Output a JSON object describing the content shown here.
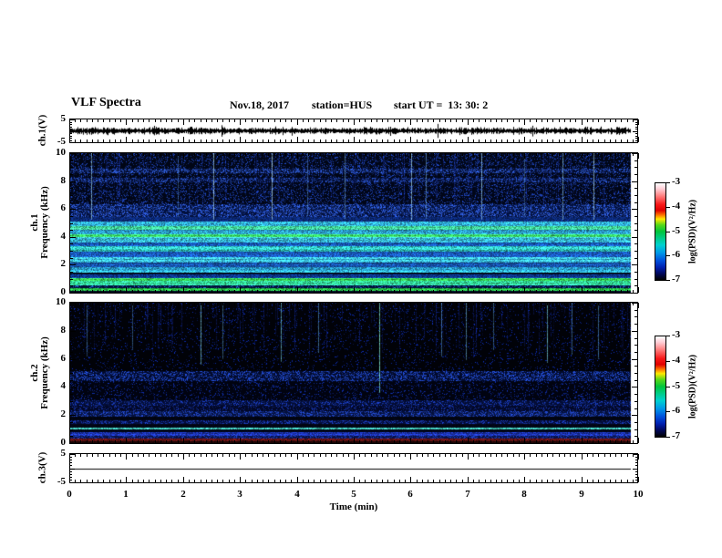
{
  "header": {
    "title": "VLF Spectra",
    "date": "Nov.18, 2017",
    "station": "station=HUS",
    "start_ut": "start UT =  13: 30: 2"
  },
  "time_axis": {
    "label": "Time (min)",
    "range": [
      0,
      10
    ],
    "major_ticks": [
      0,
      1,
      2,
      3,
      4,
      5,
      6,
      7,
      8,
      9,
      10
    ],
    "minor_step": 0.1
  },
  "freq_axis": {
    "range": [
      0,
      10
    ],
    "major_ticks": [
      10,
      8,
      6,
      4,
      2,
      0
    ],
    "minor_step": 0.5
  },
  "volt_axis": {
    "range": [
      -5,
      5
    ],
    "major_ticks": [
      5,
      -5
    ],
    "minor_step": 1
  },
  "colorbar": {
    "label": "log(PSD)(V²/Hz)",
    "ticks": [
      -3,
      -4,
      -5,
      -6,
      -7
    ],
    "gradient": [
      "#ffffff 0%",
      "#ffccd4 6%",
      "#ff8080 13%",
      "#f81818 22%",
      "#e00000 28%",
      "#ff7800 33%",
      "#ffe800 37%",
      "#58d818 43%",
      "#00c43c 50%",
      "#00cc88 57%",
      "#00d0d0 64%",
      "#0098e8 72%",
      "#0050dc 80%",
      "#0020b0 87%",
      "#000860 93%",
      "#000000 100%"
    ]
  },
  "render": {
    "data_fraction": 0.988
  },
  "chart_data": [
    {
      "type": "line",
      "name": "ch1_waveform",
      "ylabel": "ch.1(V)",
      "xlim": [
        0,
        10
      ],
      "ylim": [
        -5,
        5
      ],
      "signal": "dense broadband noise trace centered on 0 V",
      "noise_amp_v": 1.3,
      "seed": 7
    },
    {
      "type": "heatmap",
      "name": "ch1_spectrogram",
      "ylabel_lines": [
        "ch.1",
        "Frequency (kHz)"
      ],
      "xlim": [
        0,
        10
      ],
      "ylim": [
        0,
        10
      ],
      "clim": [
        -7,
        -3
      ],
      "background": "#010512",
      "seed": 13,
      "bands": [
        {
          "f": [
            0.0,
            0.15
          ],
          "color": "#000a20"
        },
        {
          "f": [
            0.15,
            0.32
          ],
          "color": "#28c048"
        },
        {
          "f": [
            0.32,
            0.55
          ],
          "color": "#020c38",
          "speckle": 0.3,
          "speckle_color": "#2060c8"
        },
        {
          "f": [
            0.55,
            0.88
          ],
          "color": "#30d890"
        },
        {
          "f": [
            0.88,
            1.02
          ],
          "color": "#38dc58"
        },
        {
          "f": [
            1.02,
            1.32
          ],
          "color": "#0c3c98"
        },
        {
          "f": [
            1.32,
            1.45
          ],
          "color": "#020818"
        },
        {
          "f": [
            1.45,
            1.82
          ],
          "color": "#2ca8dc"
        },
        {
          "f": [
            1.82,
            2.18
          ],
          "color": "#1858b8"
        },
        {
          "f": [
            2.18,
            2.55
          ],
          "color": "#38bce4"
        },
        {
          "f": [
            2.55,
            2.92
          ],
          "color": "#1854b4"
        },
        {
          "f": [
            2.92,
            3.32
          ],
          "color": "#30c8c0"
        },
        {
          "f": [
            3.32,
            3.62
          ],
          "color": "#1858b8"
        },
        {
          "f": [
            3.62,
            3.96
          ],
          "color": "#38c0e4"
        },
        {
          "f": [
            3.96,
            4.18
          ],
          "color": "#38d860"
        },
        {
          "f": [
            4.18,
            4.48
          ],
          "color": "#2ca4da"
        },
        {
          "f": [
            4.48,
            4.78
          ],
          "color": "#44e49c"
        },
        {
          "f": [
            4.78,
            5.12
          ],
          "color": "#2ea6d8"
        },
        {
          "f": [
            5.12,
            5.4
          ],
          "color": "#0a2468"
        },
        {
          "f": [
            5.4,
            6.35
          ],
          "color": "#02103e",
          "speckle": 0.5,
          "speckle_color": "#2c58d4"
        },
        {
          "f": [
            6.35,
            7.9
          ],
          "color": "#010618",
          "speckle": 0.26,
          "speckle_color": "#1c40b0"
        },
        {
          "f": [
            7.9,
            8.22
          ],
          "color": "#030c30",
          "speckle": 0.45,
          "speckle_color": "#2850c0"
        },
        {
          "f": [
            8.22,
            8.55
          ],
          "color": "#010616",
          "speckle": 0.22,
          "speckle_color": "#1c40b0"
        },
        {
          "f": [
            8.55,
            8.88
          ],
          "color": "#030c30",
          "speckle": 0.5,
          "speckle_color": "#2c58cc"
        },
        {
          "f": [
            8.88,
            10.01
          ],
          "color": "#010616",
          "speckle": 0.24,
          "speckle_color": "#1c40b0"
        }
      ],
      "faint_streaks": {
        "count": 120,
        "seed": 41,
        "color": "#2444e0",
        "alpha_range": [
          0.08,
          0.42
        ],
        "f_bottom_range": [
          5.3,
          8.2
        ]
      },
      "bright_streaks": [
        {
          "t": 0.38,
          "f_bottom": 5.25,
          "alpha": 0.75,
          "color": "#b0ecff"
        },
        {
          "t": 1.92,
          "f_bottom": 5.4,
          "alpha": 0.45,
          "color": "#78b8f0"
        },
        {
          "t": 2.56,
          "f_bottom": 5.25,
          "alpha": 0.8,
          "color": "#c0f0ff"
        },
        {
          "t": 3.6,
          "f_bottom": 5.25,
          "alpha": 0.85,
          "color": "#c8f4ff"
        },
        {
          "t": 4.22,
          "f_bottom": 5.5,
          "alpha": 0.5,
          "color": "#78b8f0"
        },
        {
          "t": 4.9,
          "f_bottom": 5.3,
          "alpha": 0.6,
          "color": "#90d0f8"
        },
        {
          "t": 6.08,
          "f_bottom": 5.25,
          "alpha": 0.8,
          "color": "#b8f0ff"
        },
        {
          "t": 6.34,
          "f_bottom": 5.3,
          "alpha": 0.6,
          "color": "#90d0f8"
        },
        {
          "t": 7.34,
          "f_bottom": 5.25,
          "alpha": 0.75,
          "color": "#b0ecff"
        },
        {
          "t": 8.1,
          "f_bottom": 5.5,
          "alpha": 0.45,
          "color": "#78b8f0"
        },
        {
          "t": 8.78,
          "f_bottom": 5.25,
          "alpha": 0.7,
          "color": "#a8e8ff"
        },
        {
          "t": 9.34,
          "f_bottom": 5.25,
          "alpha": 0.8,
          "color": "#c0f0ff"
        }
      ]
    },
    {
      "type": "heatmap",
      "name": "ch2_spectrogram",
      "ylabel_lines": [
        "ch.2",
        "Frequency (kHz)"
      ],
      "xlim": [
        0,
        10
      ],
      "ylim": [
        0,
        10
      ],
      "clim": [
        -7,
        -3
      ],
      "background": "#010208",
      "seed": 29,
      "bands": [
        {
          "f": [
            0.0,
            0.1
          ],
          "color": "#160404"
        },
        {
          "f": [
            0.1,
            0.3
          ],
          "color": "#681414"
        },
        {
          "f": [
            0.3,
            0.52
          ],
          "color": "#081048",
          "speckle": 0.5,
          "speckle_color": "#1838b0"
        },
        {
          "f": [
            0.52,
            0.8
          ],
          "color": "#1c34b0"
        },
        {
          "f": [
            0.8,
            0.96
          ],
          "color": "#020618"
        },
        {
          "f": [
            0.96,
            1.1
          ],
          "color": "#48dcc8"
        },
        {
          "f": [
            1.1,
            1.34
          ],
          "color": "#020616"
        },
        {
          "f": [
            1.34,
            1.64
          ],
          "color": "#030c38",
          "speckle": 0.5,
          "speckle_color": "#1838b0"
        },
        {
          "f": [
            1.64,
            1.88
          ],
          "color": "#020512"
        },
        {
          "f": [
            1.88,
            2.28
          ],
          "color": "#04103c",
          "speckle": 0.55,
          "speckle_color": "#2044c0"
        },
        {
          "f": [
            2.28,
            2.64
          ],
          "color": "#020828",
          "speckle": 0.3,
          "speckle_color": "#1530a0"
        },
        {
          "f": [
            2.64,
            3.04
          ],
          "color": "#030c34",
          "speckle": 0.4,
          "speckle_color": "#1838b0"
        },
        {
          "f": [
            3.04,
            4.42
          ],
          "color": "#010310",
          "speckle": 0.15,
          "speckle_color": "#102ca0"
        },
        {
          "f": [
            4.42,
            5.1
          ],
          "color": "#020a2c",
          "speckle": 0.45,
          "speckle_color": "#2048c8"
        },
        {
          "f": [
            5.1,
            10.01
          ],
          "color": "#010208",
          "speckle": 0.08,
          "speckle_color": "#0c28a0"
        }
      ],
      "faint_streaks": {
        "count": 100,
        "seed": 51,
        "color": "#1c38d0",
        "alpha_range": [
          0.1,
          0.5
        ],
        "f_bottom_range": [
          5.6,
          9.2
        ]
      },
      "bright_streaks": [
        {
          "t": 0.3,
          "f_bottom": 6.2,
          "alpha": 0.6,
          "color": "#60a8f8"
        },
        {
          "t": 1.1,
          "f_bottom": 6.6,
          "alpha": 0.55,
          "color": "#60a8f8"
        },
        {
          "t": 2.32,
          "f_bottom": 5.6,
          "alpha": 0.8,
          "color": "#90e8f8"
        },
        {
          "t": 2.72,
          "f_bottom": 6.0,
          "alpha": 0.55,
          "color": "#70c0f8"
        },
        {
          "t": 3.76,
          "f_bottom": 5.8,
          "alpha": 0.75,
          "color": "#80e0f8"
        },
        {
          "t": 4.42,
          "f_bottom": 6.4,
          "alpha": 0.6,
          "color": "#70c0f8"
        },
        {
          "t": 5.52,
          "f_bottom": 3.6,
          "alpha": 0.9,
          "color": "#8cf8e0"
        },
        {
          "t": 6.62,
          "f_bottom": 6.2,
          "alpha": 0.6,
          "color": "#70c0f8"
        },
        {
          "t": 7.06,
          "f_bottom": 5.9,
          "alpha": 0.65,
          "color": "#80d0f8"
        },
        {
          "t": 7.55,
          "f_bottom": 6.6,
          "alpha": 0.55,
          "color": "#70c0f8"
        },
        {
          "t": 8.5,
          "f_bottom": 5.7,
          "alpha": 0.75,
          "color": "#88e8f8"
        },
        {
          "t": 8.95,
          "f_bottom": 6.3,
          "alpha": 0.55,
          "color": "#70c0f8"
        },
        {
          "t": 9.42,
          "f_bottom": 6.0,
          "alpha": 0.6,
          "color": "#70c0f8"
        }
      ]
    },
    {
      "type": "line",
      "name": "ch3_waveform",
      "ylabel": "ch.3(V)",
      "xlim": [
        0,
        10
      ],
      "ylim": [
        -5,
        5
      ],
      "signal": "flat line at 0 V",
      "noise_amp_v": 0,
      "seed": 3
    }
  ]
}
